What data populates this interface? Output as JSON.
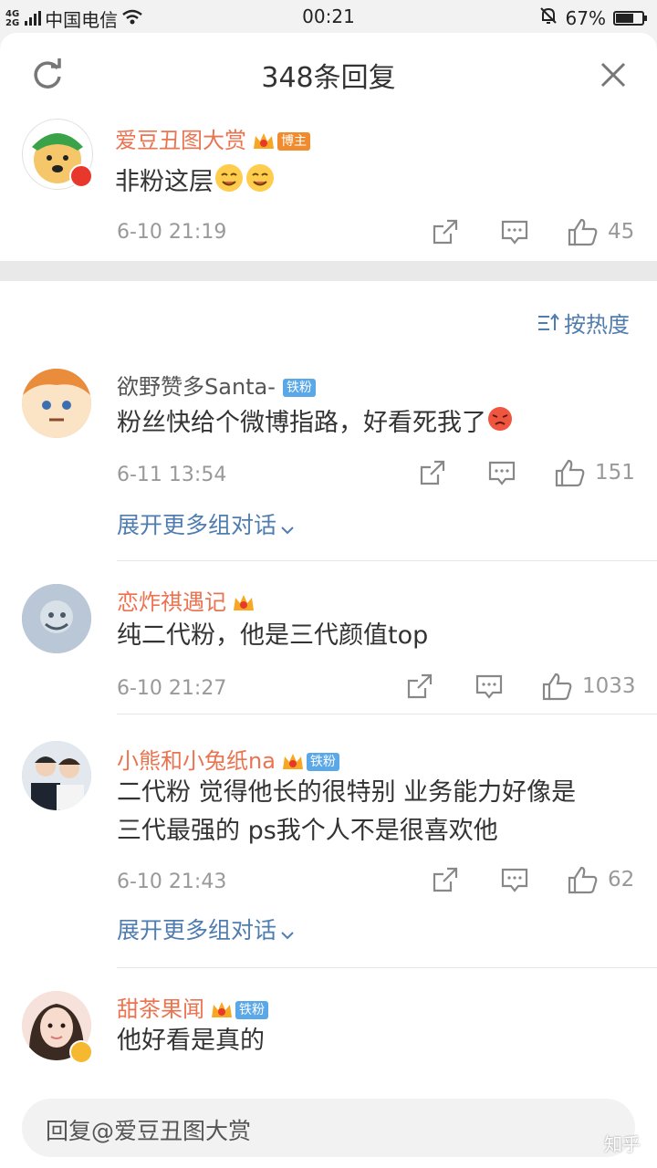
{
  "status_bar": {
    "network_top": "4G",
    "network_bottom": "2G",
    "carrier": "中国电信",
    "time": "00:21",
    "battery": "67%",
    "battery_level": 0.67
  },
  "header": {
    "title": "348条回复"
  },
  "top_comment": {
    "user": "爱豆丑图大赏",
    "tag": "博主",
    "text": "非粉这层",
    "time": "6-10 21:19",
    "likes": "45"
  },
  "sort_label": "按热度",
  "comments": [
    {
      "user": "欲野赞多Santa-",
      "tag": "铁粉",
      "text": "粉丝快给个微博指路，好看死我了",
      "time": "6-11 13:54",
      "likes": "151",
      "expand": "展开更多组对话"
    },
    {
      "user": "恋炸祺遇记",
      "text": "纯二代粉，他是三代颜值top",
      "time": "6-10 21:27",
      "likes": "1033"
    },
    {
      "user": "小熊和小兔纸na",
      "tag": "铁粉",
      "text_line1": "二代粉 觉得他长的很特别 业务能力好像是",
      "text_line2": "三代最强的 ps我个人不是很喜欢他",
      "time": "6-10 21:43",
      "likes": "62",
      "expand": "展开更多组对话"
    },
    {
      "user": "甜茶果闻",
      "tag": "铁粉",
      "text": "他好看是真的"
    }
  ],
  "reply_bar": {
    "placeholder": "回复@爱豆丑图大赏"
  },
  "watermark": "知乎"
}
